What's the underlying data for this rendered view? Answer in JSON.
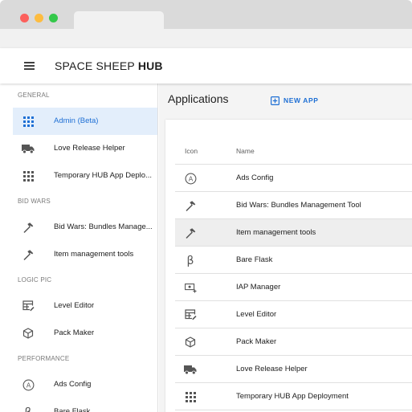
{
  "app": {
    "title_light": "SPACE SHEEP ",
    "title_bold": "HUB"
  },
  "sidebar": {
    "sections": [
      {
        "label": "GENERAL",
        "items": [
          {
            "label": "Admin (Beta)",
            "icon": "grid-icon",
            "active": true
          },
          {
            "label": "Love Release Helper",
            "icon": "truck-icon"
          },
          {
            "label": "Temporary HUB App Deplo...",
            "icon": "grid-icon"
          }
        ]
      },
      {
        "label": "BID WARS",
        "items": [
          {
            "label": "Bid Wars: Bundles Manage...",
            "icon": "hammer-icon"
          },
          {
            "label": "Item management tools",
            "icon": "hammer-icon"
          }
        ]
      },
      {
        "label": "LOGIC PIC",
        "items": [
          {
            "label": "Level Editor",
            "icon": "table-edit-icon"
          },
          {
            "label": "Pack Maker",
            "icon": "cube-icon"
          }
        ]
      },
      {
        "label": "PERFORMANCE",
        "items": [
          {
            "label": "Ads Config",
            "icon": "circle-a-icon"
          },
          {
            "label": "Bare Flask",
            "icon": "beta-icon"
          }
        ]
      }
    ]
  },
  "main": {
    "title": "Applications",
    "new_app_label": "NEW APP",
    "columns": {
      "icon": "Icon",
      "name": "Name"
    },
    "rows": [
      {
        "name": "Ads Config",
        "icon": "circle-a-icon"
      },
      {
        "name": "Bid Wars: Bundles Management Tool",
        "icon": "hammer-icon"
      },
      {
        "name": "Item management tools",
        "icon": "hammer-icon",
        "highlighted": true
      },
      {
        "name": "Bare Flask",
        "icon": "beta-icon"
      },
      {
        "name": "IAP Manager",
        "icon": "cash-plus-icon"
      },
      {
        "name": "Level Editor",
        "icon": "table-edit-icon"
      },
      {
        "name": "Pack Maker",
        "icon": "cube-icon"
      },
      {
        "name": "Love Release Helper",
        "icon": "truck-icon"
      },
      {
        "name": "Temporary HUB App Deployment",
        "icon": "grid-icon"
      }
    ]
  },
  "colors": {
    "accent": "#1e6fd4",
    "active_bg": "#e3eefb",
    "icon": "#555555"
  }
}
